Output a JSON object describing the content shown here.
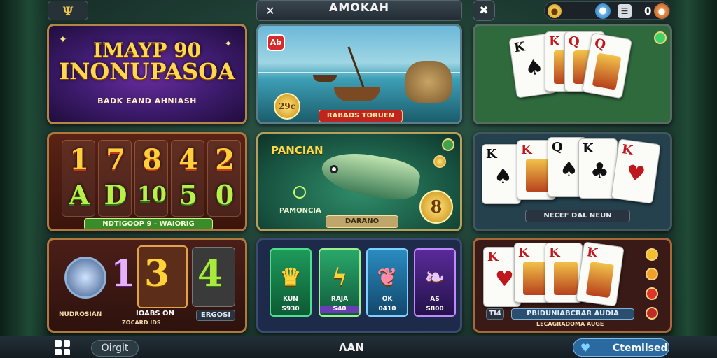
{
  "header": {
    "left_badge": "Ψ",
    "title": "AMOKAH",
    "right_value": "0"
  },
  "tiles": {
    "slots_banner": {
      "title_line1": "IMAYP 90",
      "title_line2": "INONUPASOA",
      "subtitle": "BADK EAND AHNIASH"
    },
    "fishing": {
      "badge": "Ab",
      "coin_value": "29c",
      "ribbon": "RABADS TORUEN"
    },
    "cards_top": {},
    "number_reels": {
      "row1": [
        "1",
        "7",
        "8",
        "4",
        "2"
      ],
      "row2": [
        "A",
        "D",
        "10",
        "5",
        "0"
      ],
      "ribbon": "NDTIGOOP 9 - WAIORIG"
    },
    "fish_game": {
      "title": "PANCIAN",
      "left_label": "PAMONCIA",
      "ribbon": "DARANO",
      "coin_value": "8"
    },
    "cards_mid": {
      "ribbon": "NECEF DAL NEUN"
    },
    "symbols_left": {
      "big_digits": [
        "1",
        "3",
        "4"
      ],
      "label_left": "NUDROSIAN",
      "label_mid": "IOABS ON",
      "label_mid_sub": "ZOCARD IDS",
      "label_right": "ERGOSI"
    },
    "symbols_mid": {
      "items": [
        {
          "label": "KUN",
          "value": "S930"
        },
        {
          "label": "RAJA",
          "value": "S40"
        },
        {
          "label": "OK",
          "value": "0410"
        },
        {
          "label": "AS",
          "value": "S800"
        }
      ]
    },
    "cards_bottom": {
      "ribbon_left": "TI4",
      "ribbon": "PBIDUNIABCRAR AUDIA",
      "ribbon_sub": "LECAGRADOMA AUGE"
    }
  },
  "footer": {
    "left_button": "Oirgit",
    "center_label": "ΛAN",
    "right_button": "Ctemilsed"
  },
  "colors": {
    "gold": "#ffd64d",
    "ribbon_red": "#c0251d",
    "ribbon_green": "#3a8b2a",
    "footer_blue": "#2a6aa1"
  }
}
